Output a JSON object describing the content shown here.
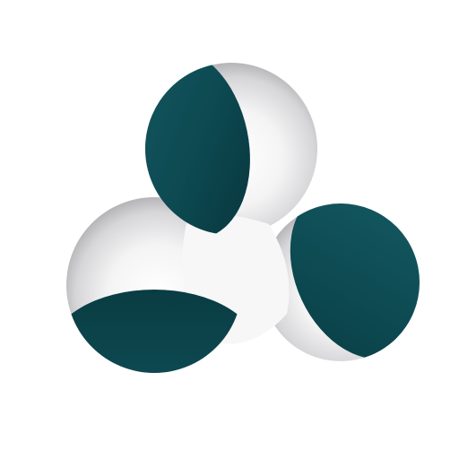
{
  "image": {
    "kind": "logo",
    "background": "#ffffff"
  },
  "logo": {
    "icon_name": "three-lobed-trefoil-logo-icon",
    "lobe_count": 3,
    "colors": {
      "accent_teal": "#0d4a52",
      "accent_teal_dark": "#08343b",
      "accent_teal_light": "#155a63",
      "silver_light": "#ffffff",
      "silver_mid": "#e4e4e6",
      "silver_dark": "#9a9b9e"
    }
  }
}
